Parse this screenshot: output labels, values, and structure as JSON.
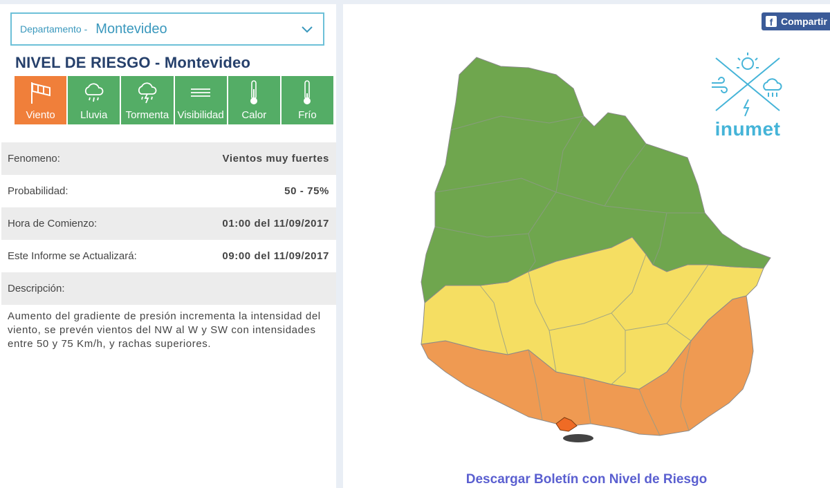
{
  "department": {
    "prefix": "Departamento -",
    "value": "Montevideo"
  },
  "title": "NIVEL DE RIESGO - Montevideo",
  "tabs": [
    {
      "label": "Viento",
      "icon": "windsock-icon",
      "active": true
    },
    {
      "label": "Lluvia",
      "icon": "rain-cloud-icon",
      "active": false
    },
    {
      "label": "Tormenta",
      "icon": "storm-cloud-icon",
      "active": false
    },
    {
      "label": "Visibilidad",
      "icon": "fog-lines-icon",
      "active": false
    },
    {
      "label": "Calor",
      "icon": "thermometer-icon",
      "active": false
    },
    {
      "label": "Frío",
      "icon": "thermometer-icon",
      "active": false
    }
  ],
  "details": [
    {
      "label": "Fenomeno:",
      "value": "Vientos muy fuertes"
    },
    {
      "label": "Probabilidad:",
      "value": "50 - 75%"
    },
    {
      "label": "Hora de Comienzo:",
      "value": "01:00 del 11/09/2017"
    },
    {
      "label": "Este Informe se Actualizará:",
      "value": "09:00 del 11/09/2017"
    },
    {
      "label": "Descripción:",
      "value": ""
    }
  ],
  "description": "Aumento del gradiente de presión incrementa la intensidad del viento, se prevén vientos del NW al W y SW con intensidades entre 50 y 75 Km/h, y rachas superiores.",
  "share_label": "Compartir",
  "logo_text": "inumet",
  "download_link": "Descargar Boletín con Nivel de Riesgo",
  "colors": {
    "active_tab": "#f07f3a",
    "tab": "#54ad66",
    "risk_green": "#6fa64e",
    "risk_yellow": "#f5de62",
    "risk_orange": "#ef9a52",
    "risk_red_orange": "#ef6b25",
    "title": "#26406b"
  }
}
